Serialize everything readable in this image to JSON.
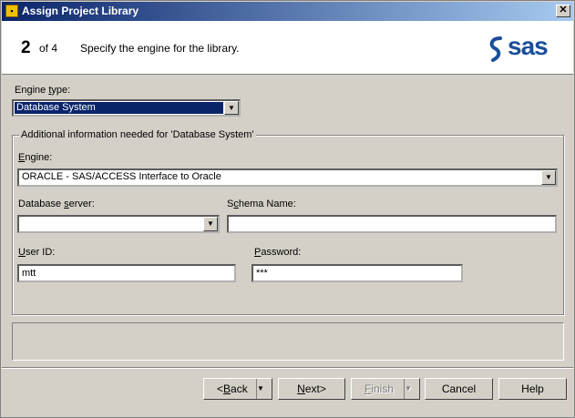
{
  "window": {
    "title": "Assign Project Library",
    "close_glyph": "✕"
  },
  "header": {
    "step_number": "2",
    "step_of": "of 4",
    "description": "Specify the engine for the library.",
    "logo_text": "sas"
  },
  "engine_type": {
    "label_pre": "Engine ",
    "label_u": "t",
    "label_post": "ype:",
    "value": "Database System"
  },
  "group": {
    "label": "Additional information needed for 'Database System'"
  },
  "engine": {
    "label_u": "E",
    "label_post": "ngine:",
    "value": "ORACLE - SAS/ACCESS Interface to Oracle"
  },
  "db_server": {
    "label_pre": "Database ",
    "label_u": "s",
    "label_post": "erver:",
    "value": ""
  },
  "schema": {
    "label_pre": "S",
    "label_u": "c",
    "label_post": "hema Name:",
    "value": ""
  },
  "user_id": {
    "label_u": "U",
    "label_post": "ser ID:",
    "value": "mtt"
  },
  "password": {
    "label_u": "P",
    "label_post": "assword:",
    "value": "***"
  },
  "buttons": {
    "back_u": "B",
    "back_post": "ack",
    "back_pre": "<",
    "next_u": "N",
    "next_post": "ext>",
    "finish_u": "F",
    "finish_post": "inish",
    "cancel": "Cancel",
    "help": "Help"
  },
  "colors": {
    "title_start": "#0a246a",
    "title_end": "#a6caf0",
    "selection": "#0a246a",
    "logo": "#1a4e9a"
  }
}
